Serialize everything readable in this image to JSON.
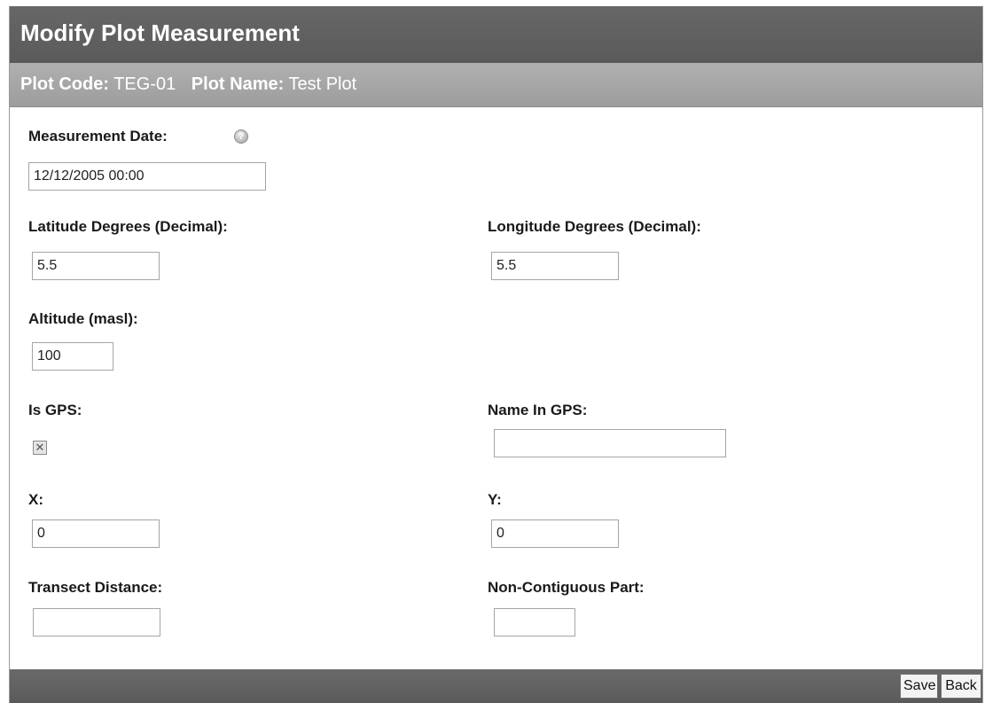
{
  "title": "Modify Plot Measurement",
  "plot_info": {
    "code_label": "Plot Code:",
    "code_value": "TEG-01",
    "name_label": "Plot Name:",
    "name_value": "Test Plot"
  },
  "fields": {
    "measurement_date": {
      "label": "Measurement Date:",
      "value": "12/12/2005 00:00"
    },
    "latitude": {
      "label": "Latitude Degrees (Decimal):",
      "value": "5.5"
    },
    "longitude": {
      "label": "Longitude Degrees (Decimal):",
      "value": "5.5"
    },
    "altitude": {
      "label": "Altitude (masl):",
      "value": "100"
    },
    "is_gps": {
      "label": "Is GPS:",
      "checked": true
    },
    "name_in_gps": {
      "label": "Name In GPS:",
      "value": ""
    },
    "x": {
      "label": "X:",
      "value": "0"
    },
    "y": {
      "label": "Y:",
      "value": "0"
    },
    "transect_distance": {
      "label": "Transect Distance:",
      "value": ""
    },
    "non_contiguous_part": {
      "label": "Non-Contiguous Part:",
      "value": ""
    }
  },
  "buttons": {
    "save": "Save",
    "back": "Back"
  },
  "icons": {
    "help": "help-icon",
    "checkbox_mark": "✕"
  },
  "colors": {
    "title_bar": "#5f5f5f",
    "sub_bar": "#a6a6a6",
    "footer_bar": "#606060"
  }
}
